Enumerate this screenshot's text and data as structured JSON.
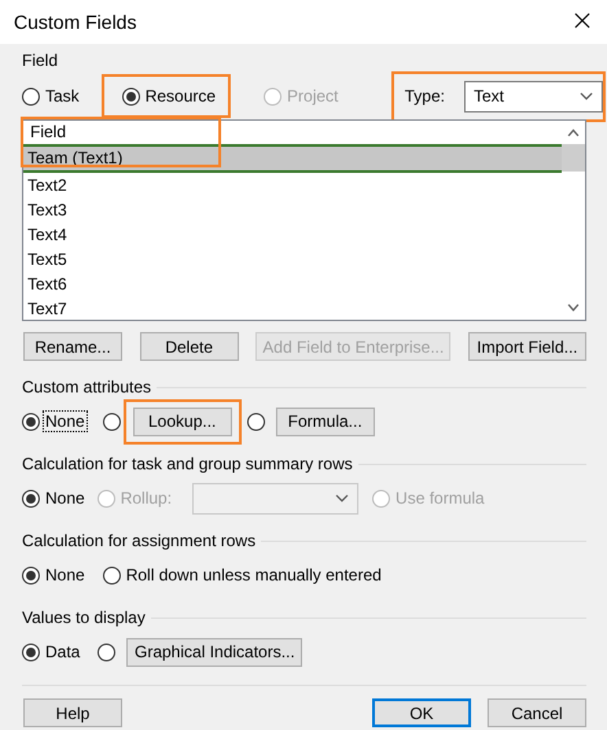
{
  "window": {
    "title": "Custom Fields"
  },
  "field_group": {
    "title": "Field",
    "options": [
      {
        "label": "Task",
        "selected": false,
        "disabled": false,
        "highlighted": false
      },
      {
        "label": "Resource",
        "selected": true,
        "disabled": false,
        "highlighted": true
      },
      {
        "label": "Project",
        "selected": false,
        "disabled": true,
        "highlighted": false
      }
    ],
    "type": {
      "label": "Type:",
      "value": "Text",
      "highlighted": true
    }
  },
  "field_list": {
    "header": "Field",
    "highlighted": true,
    "rows": [
      {
        "label": "Team (Text1)",
        "selected": true
      },
      {
        "label": "Text2",
        "selected": false
      },
      {
        "label": "Text3",
        "selected": false
      },
      {
        "label": "Text4",
        "selected": false
      },
      {
        "label": "Text5",
        "selected": false
      },
      {
        "label": "Text6",
        "selected": false
      },
      {
        "label": "Text7",
        "selected": false
      }
    ]
  },
  "list_buttons": [
    {
      "label": "Rename...",
      "disabled": false
    },
    {
      "label": "Delete",
      "disabled": false
    },
    {
      "label": "Add Field to Enterprise...",
      "disabled": true
    },
    {
      "label": "Import Field...",
      "disabled": false
    }
  ],
  "sections": [
    {
      "title": "Custom attributes",
      "items": [
        {
          "kind": "radio",
          "label": "None",
          "selected": true,
          "focused": true,
          "disabled": false
        },
        {
          "kind": "radio-button",
          "button": "Lookup...",
          "selected": false,
          "highlighted": true,
          "disabled": false
        },
        {
          "kind": "radio-button",
          "button": "Formula...",
          "selected": false,
          "highlighted": false,
          "disabled": false
        }
      ]
    },
    {
      "title": "Calculation for task and group summary rows",
      "items": [
        {
          "kind": "radio",
          "label": "None",
          "selected": true,
          "focused": false,
          "disabled": false
        },
        {
          "kind": "radio-dropdown",
          "label": "Rollup:",
          "selected": false,
          "disabled": true
        },
        {
          "kind": "radio",
          "label": "Use formula",
          "selected": false,
          "focused": false,
          "disabled": true
        }
      ]
    },
    {
      "title": "Calculation for assignment rows",
      "items": [
        {
          "kind": "radio",
          "label": "None",
          "selected": true,
          "focused": false,
          "disabled": false
        },
        {
          "kind": "radio",
          "label": "Roll down unless manually entered",
          "selected": false,
          "focused": false,
          "disabled": false
        }
      ]
    },
    {
      "title": "Values to display",
      "items": [
        {
          "kind": "radio",
          "label": "Data",
          "selected": true,
          "focused": false,
          "disabled": false
        },
        {
          "kind": "radio-button",
          "button": "Graphical Indicators...",
          "selected": false,
          "highlighted": false,
          "disabled": false
        }
      ]
    }
  ],
  "footer_buttons": [
    {
      "label": "Help",
      "default": false
    },
    {
      "label": "OK",
      "default": true
    },
    {
      "label": "Cancel",
      "default": false
    }
  ]
}
